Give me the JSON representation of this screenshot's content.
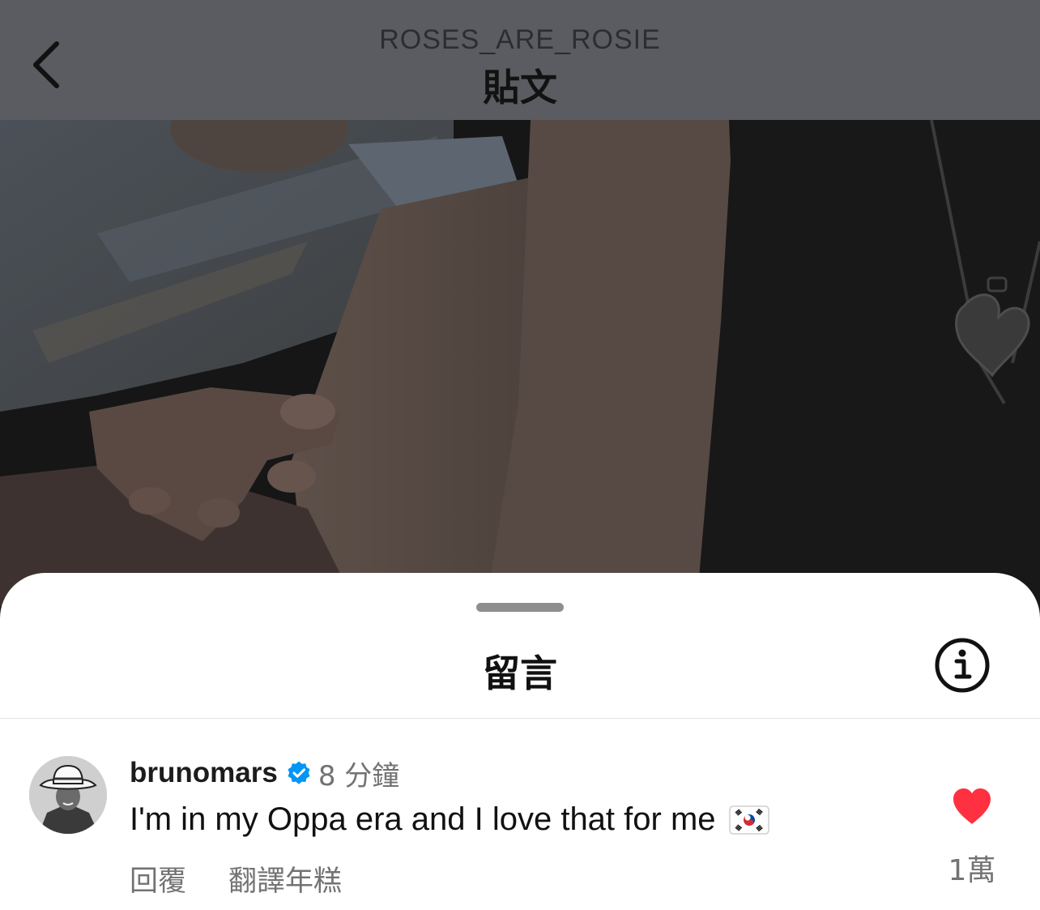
{
  "header": {
    "account": "ROSES_ARE_ROSIE",
    "title": "貼文",
    "back_icon": "chevron-left-icon"
  },
  "post": {
    "image_icon": "photo"
  },
  "comments_sheet": {
    "title": "留言",
    "info_icon": "info-icon"
  },
  "comment": {
    "username": "brunomars",
    "verified": true,
    "timestamp": "8 分鐘",
    "text": "I'm in my Oppa era and I love that for me",
    "emoji": "south-korea-flag",
    "reply_label": "回覆",
    "translate_label": "翻譯年糕",
    "like_icon": "heart-filled-icon",
    "like_count": "1萬",
    "colors": {
      "heart": "#ff3040",
      "verified": "#0095f6"
    }
  }
}
